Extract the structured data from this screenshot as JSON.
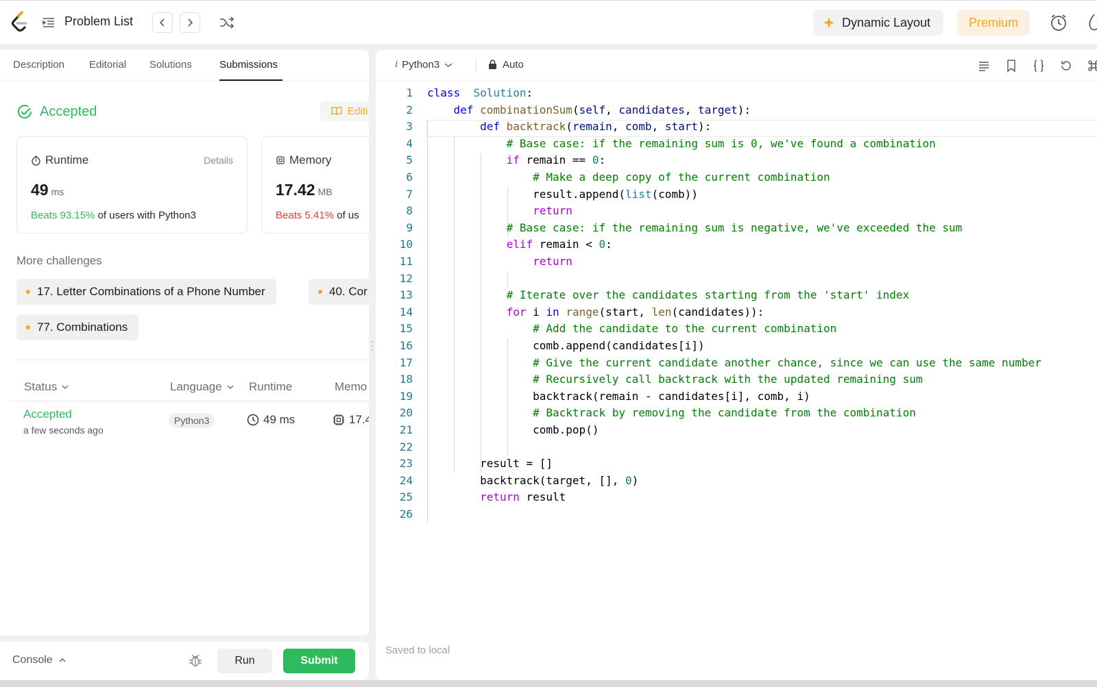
{
  "topbar": {
    "title": "Problem List",
    "dynamic_layout": "Dynamic Layout",
    "premium": "Premium"
  },
  "left": {
    "tabs": [
      "Description",
      "Editorial",
      "Solutions",
      "Submissions"
    ],
    "status_title": "Accepted",
    "editorial_btn": "Editi",
    "runtime": {
      "label": "Runtime",
      "details": "Details",
      "value": "49",
      "unit": "ms",
      "beats": "Beats 93.15%",
      "beats_suffix": "of users with Python3"
    },
    "memory": {
      "label": "Memory",
      "value": "17.42",
      "unit": "MB",
      "beats": "Beats 5.41%",
      "beats_suffix": "of us"
    },
    "more_challenges": "More challenges",
    "challenges": [
      "17. Letter Combinations of a Phone Number",
      "40. Cor",
      "77. Combinations"
    ],
    "table": {
      "headers": [
        "Status",
        "Language",
        "Runtime",
        "Memo"
      ],
      "row": {
        "status": "Accepted",
        "time": "a few seconds ago",
        "language": "Python3",
        "runtime": "49 ms",
        "memory": "17.4"
      }
    }
  },
  "console": {
    "label": "Console",
    "run": "Run",
    "submit": "Submit"
  },
  "editor": {
    "language": "Python3",
    "mode": "Auto",
    "saved": "Saved to local",
    "current_line": 2,
    "lines": [
      [
        [
          "kw",
          "class"
        ],
        [
          "",
          "  "
        ],
        [
          "cls",
          "Solution"
        ],
        [
          "",
          ":"
        ]
      ],
      [
        [
          "",
          "    "
        ],
        [
          "kw",
          "def"
        ],
        [
          "",
          " "
        ],
        [
          "fn",
          "combinationSum"
        ],
        [
          "",
          "("
        ],
        [
          "par",
          "self"
        ],
        [
          "",
          ", "
        ],
        [
          "par",
          "candidates"
        ],
        [
          "",
          ", "
        ],
        [
          "par",
          "target"
        ],
        [
          "",
          "):"
        ]
      ],
      [
        [
          "",
          "        "
        ],
        [
          "kw",
          "def"
        ],
        [
          "",
          " "
        ],
        [
          "fn",
          "backtrack"
        ],
        [
          "",
          "("
        ],
        [
          "par",
          "remain"
        ],
        [
          "",
          ", "
        ],
        [
          "par",
          "comb"
        ],
        [
          "",
          ", "
        ],
        [
          "par",
          "start"
        ],
        [
          "",
          "):"
        ]
      ],
      [
        [
          "",
          "            "
        ],
        [
          "com",
          "# Base case: if the remaining sum is 0, we've found a combination"
        ]
      ],
      [
        [
          "",
          "            "
        ],
        [
          "kw2",
          "if"
        ],
        [
          "",
          " remain == "
        ],
        [
          "num",
          "0"
        ],
        [
          "",
          ":"
        ]
      ],
      [
        [
          "",
          "                "
        ],
        [
          "com",
          "# Make a deep copy of the current combination"
        ]
      ],
      [
        [
          "",
          "                result.append("
        ],
        [
          "cls",
          "list"
        ],
        [
          "",
          "(comb))"
        ]
      ],
      [
        [
          "",
          "                "
        ],
        [
          "kw2",
          "return"
        ]
      ],
      [
        [
          "",
          "            "
        ],
        [
          "com",
          "# Base case: if the remaining sum is negative, we've exceeded the sum"
        ]
      ],
      [
        [
          "",
          "            "
        ],
        [
          "kw2",
          "elif"
        ],
        [
          "",
          " remain < "
        ],
        [
          "num",
          "0"
        ],
        [
          "",
          ":"
        ]
      ],
      [
        [
          "",
          "                "
        ],
        [
          "kw2",
          "return"
        ]
      ],
      [
        [
          "",
          ""
        ]
      ],
      [
        [
          "",
          "            "
        ],
        [
          "com",
          "# Iterate over the candidates starting from the 'start' index"
        ]
      ],
      [
        [
          "",
          "            "
        ],
        [
          "kw2",
          "for"
        ],
        [
          "",
          " i "
        ],
        [
          "kw",
          "in"
        ],
        [
          "",
          " "
        ],
        [
          "bi",
          "range"
        ],
        [
          "",
          "(start, "
        ],
        [
          "bi",
          "len"
        ],
        [
          "",
          "(candidates)):"
        ]
      ],
      [
        [
          "",
          "                "
        ],
        [
          "com",
          "# Add the candidate to the current combination"
        ]
      ],
      [
        [
          "",
          "                comb.append(candidates[i])"
        ]
      ],
      [
        [
          "",
          "                "
        ],
        [
          "com",
          "# Give the current candidate another chance, since we can use the same number"
        ]
      ],
      [
        [
          "",
          "                "
        ],
        [
          "com",
          "# Recursively call backtrack with the updated remaining sum"
        ]
      ],
      [
        [
          "",
          "                backtrack(remain - candidates[i], comb, i)"
        ]
      ],
      [
        [
          "",
          "                "
        ],
        [
          "com",
          "# Backtrack by removing the candidate from the combination"
        ]
      ],
      [
        [
          "",
          "                comb.pop()"
        ]
      ],
      [
        [
          "",
          ""
        ]
      ],
      [
        [
          "",
          "        result = []"
        ]
      ],
      [
        [
          "",
          "        backtrack(target, [], "
        ],
        [
          "num",
          "0"
        ],
        [
          "",
          ")"
        ]
      ],
      [
        [
          "",
          "        "
        ],
        [
          "kw2",
          "return"
        ],
        [
          "",
          " result"
        ]
      ],
      [
        [
          "",
          ""
        ]
      ]
    ]
  }
}
